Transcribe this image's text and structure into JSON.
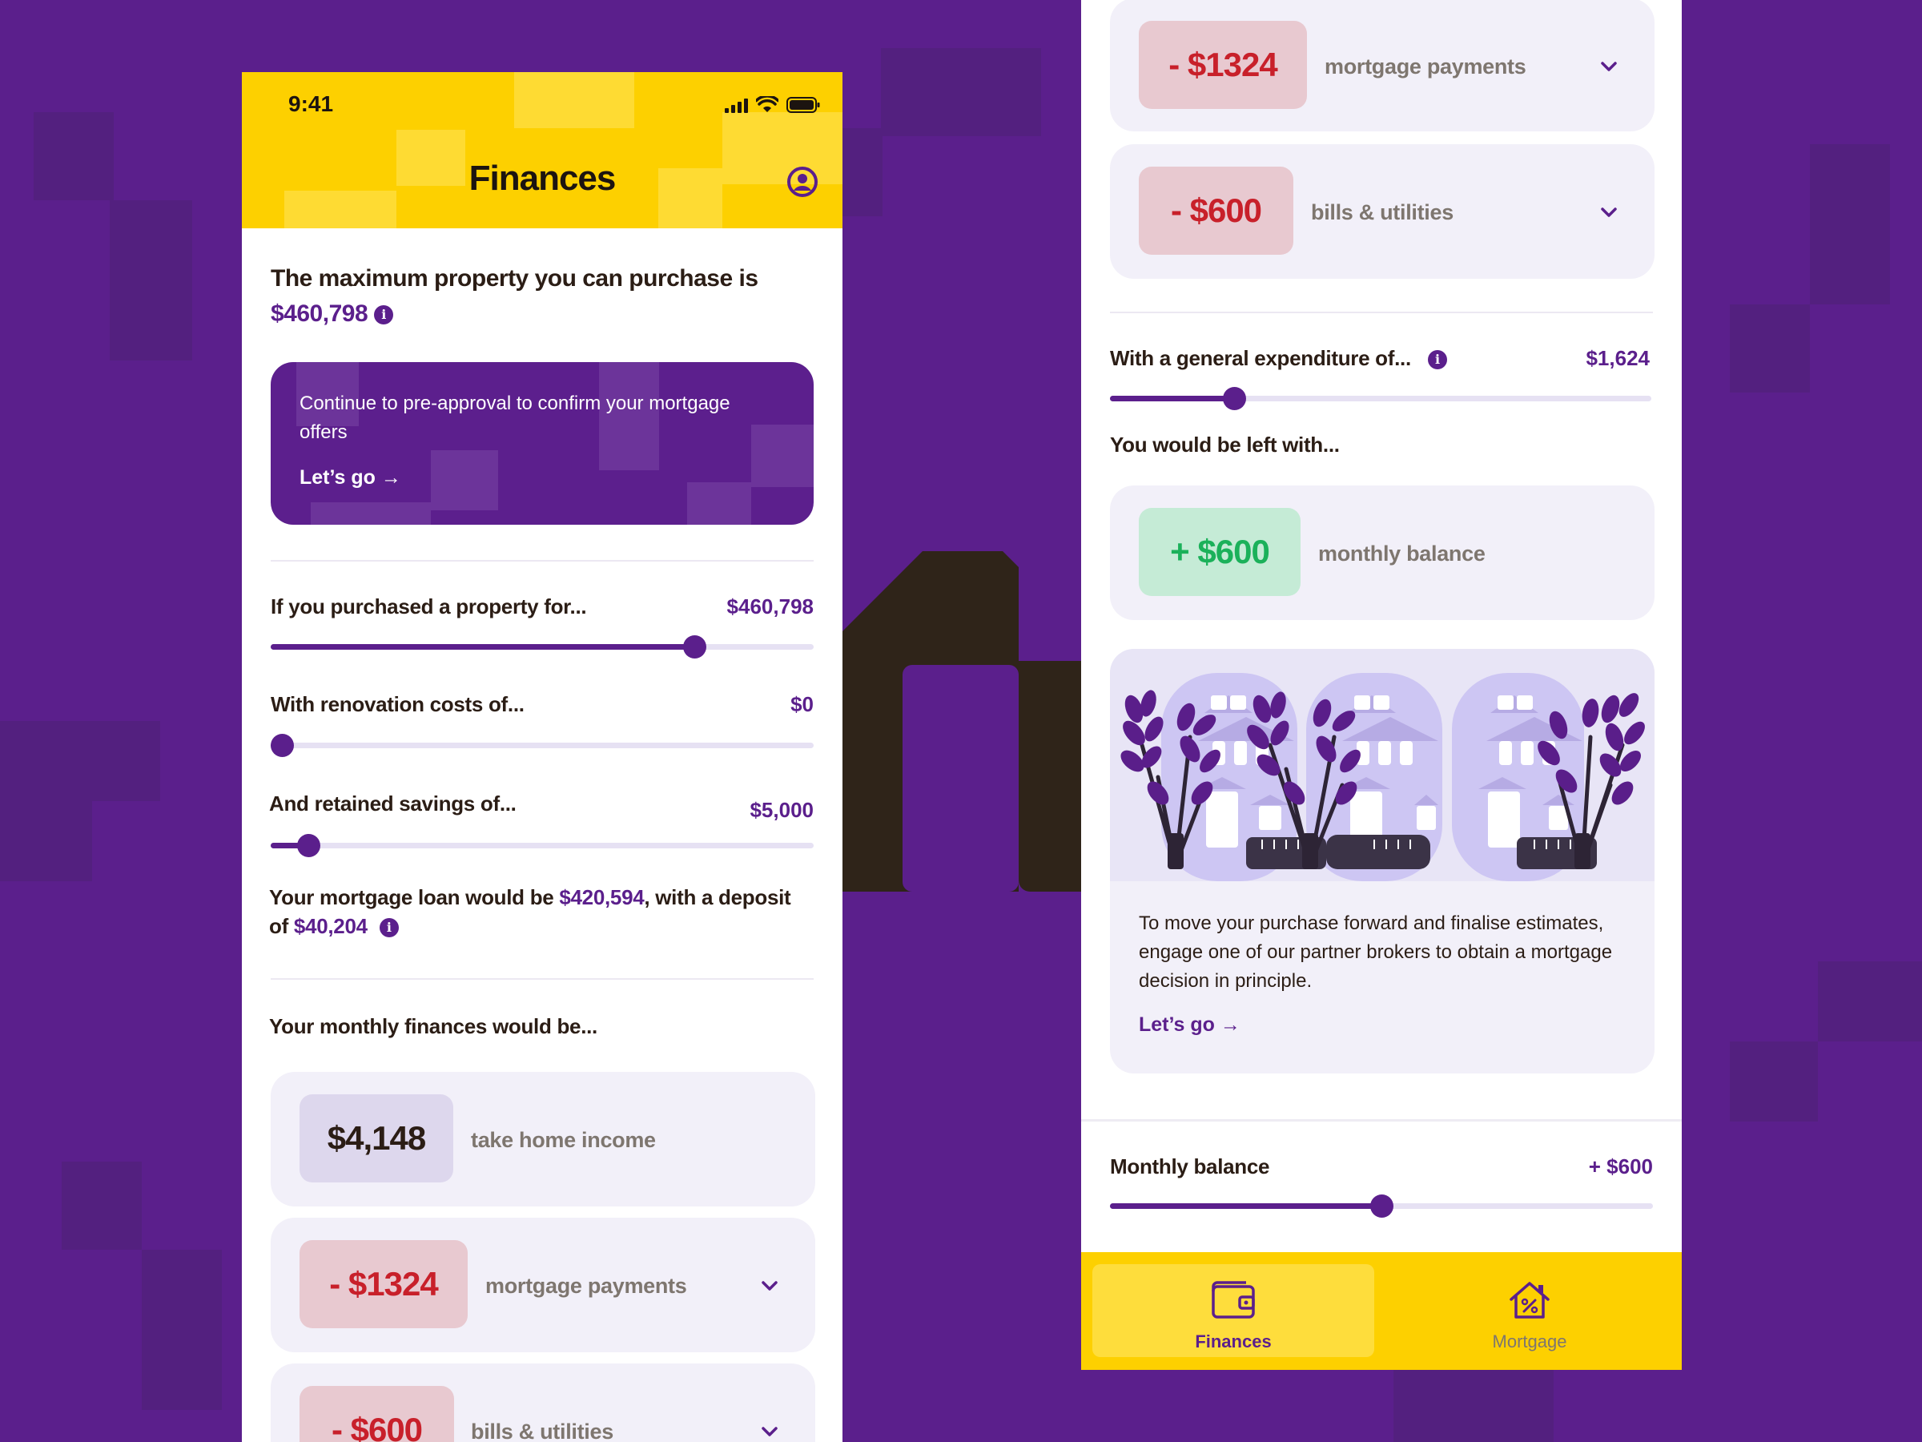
{
  "colors": {
    "background": "#5b1f8c",
    "accent_yellow": "#fdd000",
    "brand_purple": "#5b1f8c",
    "negative": "#c8202a",
    "positive": "#1bb15a"
  },
  "left": {
    "status": {
      "time": "9:41"
    },
    "header": {
      "title": "Finances",
      "profile_icon": "profile-icon"
    },
    "max_property": {
      "text": "The maximum property you can purchase is",
      "value": "$460,798"
    },
    "promo": {
      "text": "Continue to pre-approval to confirm your mortgage offers",
      "link": "Let’s go →"
    },
    "purchase": {
      "label": "If you purchased a property for...",
      "value": "$460,798",
      "level": 0.78
    },
    "renovation": {
      "label": "With renovation costs of...",
      "value": "$0",
      "level": 0.02
    },
    "savings": {
      "label": "And retained savings of...",
      "value": "$5,000",
      "level": 0.07
    },
    "loan": {
      "prefix": "Your mortgage loan would be ",
      "loan_value": "$420,594",
      "middle": ", with a deposit of ",
      "deposit_value": "$40,204"
    },
    "monthly_heading": "Your monthly finances would be...",
    "cards": [
      {
        "amount": "$4,148",
        "label": "take home income"
      },
      {
        "amount": "- $1324",
        "label": "mortgage payments"
      },
      {
        "amount": "- $600",
        "label": "bills & utilities"
      }
    ]
  },
  "right": {
    "cards": [
      {
        "amount": "- $1324",
        "label": "mortgage payments"
      },
      {
        "amount": "- $600",
        "label": "bills & utilities"
      }
    ],
    "expenditure": {
      "label": "With a general expenditure of...",
      "value": "$1,624",
      "level": 0.23
    },
    "left_with": "You would be left with...",
    "balance_card": {
      "amount": "+ $600",
      "label": "monthly balance"
    },
    "broker": {
      "text": "To move your purchase forward and finalise estimates, engage one of our partner brokers to obtain a mortgage decision in principle.",
      "link": "Let’s go →"
    },
    "monthly_balance": {
      "label": "Monthly balance",
      "value": "+ $600",
      "level": 0.5
    },
    "nav": [
      {
        "label": "Finances",
        "icon": "wallet-icon",
        "active": true
      },
      {
        "label": "Mortgage",
        "icon": "house-percent-icon",
        "active": false
      }
    ]
  }
}
